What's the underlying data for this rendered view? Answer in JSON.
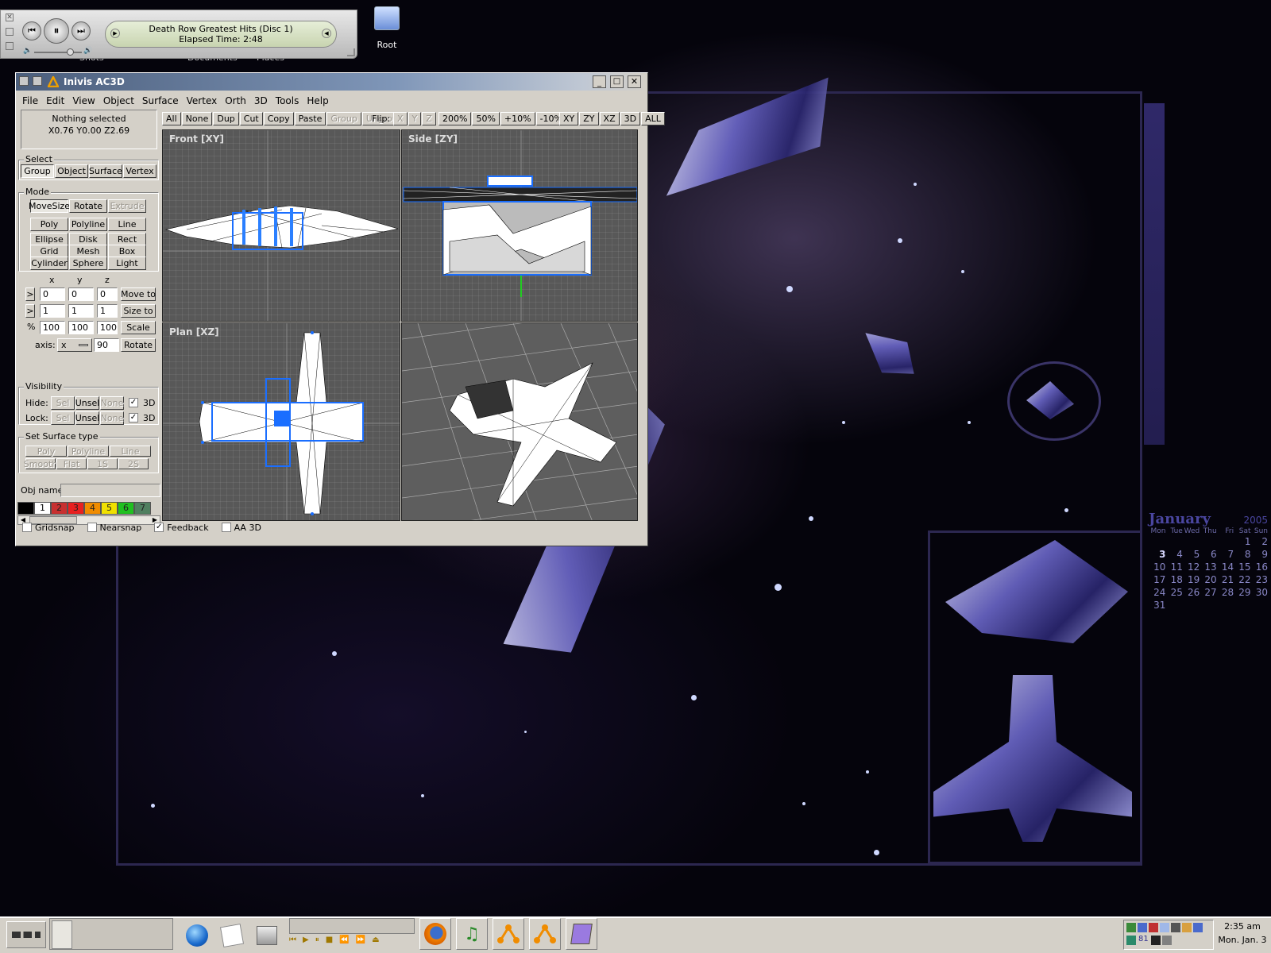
{
  "desktop": {
    "icon_root": "Root",
    "partial_icons": [
      "Shots",
      "Documents",
      "Places"
    ],
    "calendar": {
      "month": "January",
      "year": "2005",
      "days_header": [
        "Mon",
        "Tue",
        "Wed",
        "Thu",
        "Fri",
        "Sat",
        "Sun"
      ],
      "weeks": [
        [
          "",
          "",
          "",
          "",
          "",
          "1",
          "2"
        ],
        [
          "3",
          "4",
          "5",
          "6",
          "7",
          "8",
          "9"
        ],
        [
          "10",
          "11",
          "12",
          "13",
          "14",
          "15",
          "16"
        ],
        [
          "17",
          "18",
          "19",
          "20",
          "21",
          "22",
          "23"
        ],
        [
          "24",
          "25",
          "26",
          "27",
          "28",
          "29",
          "30"
        ],
        [
          "31",
          "",
          "",
          "",
          "",
          "",
          ""
        ]
      ],
      "today": "3"
    }
  },
  "media_player": {
    "track": "Death Row Greatest Hits (Disc 1)",
    "elapsed": "Elapsed Time: 2:48"
  },
  "window": {
    "title": "Inivis AC3D",
    "menu": [
      "File",
      "Edit",
      "View",
      "Object",
      "Surface",
      "Vertex",
      "Orth",
      "3D",
      "Tools",
      "Help"
    ],
    "toolbar": {
      "left": [
        "All",
        "None",
        "Dup",
        "Cut",
        "Copy",
        "Paste",
        "Group",
        "Ungroup"
      ],
      "flip_label": "Flip:",
      "flip": [
        "X",
        "Y",
        "Z"
      ],
      "zoom": [
        "200%",
        "50%",
        "+10%",
        "-10%"
      ],
      "views": [
        "XY",
        "ZY",
        "XZ",
        "3D",
        "ALL"
      ]
    },
    "status": {
      "line1": "Nothing selected",
      "line2": "X0.76 Y0.00 Z2.69"
    },
    "select": {
      "title": "Select",
      "buttons": [
        "Group",
        "Object",
        "Surface",
        "Vertex"
      ]
    },
    "mode": {
      "title": "Mode",
      "row1": [
        "MoveSize",
        "Rotate",
        "Extrude"
      ],
      "row2": [
        "Poly",
        "Polyline",
        "Line"
      ],
      "row3": [
        "Ellipse",
        "Disk",
        "Rect"
      ],
      "row4": [
        "Grid",
        "Mesh",
        "Box"
      ],
      "row5": [
        "Cylinder",
        "Sphere",
        "Light"
      ]
    },
    "xyz": {
      "headers": [
        "x",
        "y",
        "z"
      ],
      "move": {
        "values": [
          "0",
          "0",
          "0"
        ],
        "btn": "Move to"
      },
      "size": {
        "values": [
          "1",
          "1",
          "1"
        ],
        "btn": "Size to"
      },
      "scale": {
        "label": "%",
        "values": [
          "100",
          "100",
          "100"
        ],
        "btn": "Scale"
      },
      "rotate": {
        "label": "axis:",
        "axis": "x",
        "value": "90",
        "btn": "Rotate"
      }
    },
    "visibility": {
      "title": "Visibility",
      "hide_label": "Hide:",
      "lock_label": "Lock:",
      "buttons": [
        "Sel",
        "Unsel",
        "None"
      ],
      "check_label": "3D"
    },
    "surface_type": {
      "title": "Set Surface type",
      "row1": [
        "Poly",
        "Polyline",
        "Line"
      ],
      "row2": [
        "Smooth",
        "Flat",
        "1S",
        "2S"
      ]
    },
    "obj_name_label": "Obj name:",
    "palette": [
      {
        "n": "",
        "c": "#000000"
      },
      {
        "n": "1",
        "c": "#ffffff"
      },
      {
        "n": "2",
        "c": "#c83030"
      },
      {
        "n": "3",
        "c": "#e82020"
      },
      {
        "n": "4",
        "c": "#f08c00"
      },
      {
        "n": "5",
        "c": "#f0e000"
      },
      {
        "n": "6",
        "c": "#20c020"
      },
      {
        "n": "7",
        "c": "#508060"
      }
    ],
    "viewports": {
      "front": "Front [XY]",
      "side": "Side [ZY]",
      "plan": "Plan [XZ]"
    },
    "bottom": [
      {
        "label": "Gridsnap",
        "checked": false
      },
      {
        "label": "Nearsnap",
        "checked": false
      },
      {
        "label": "Feedback",
        "checked": true
      },
      {
        "label": "AA 3D",
        "checked": false
      }
    ]
  },
  "taskbar": {
    "time": "2:35 am",
    "date": "Mon. Jan. 3",
    "tray_number": "81"
  }
}
